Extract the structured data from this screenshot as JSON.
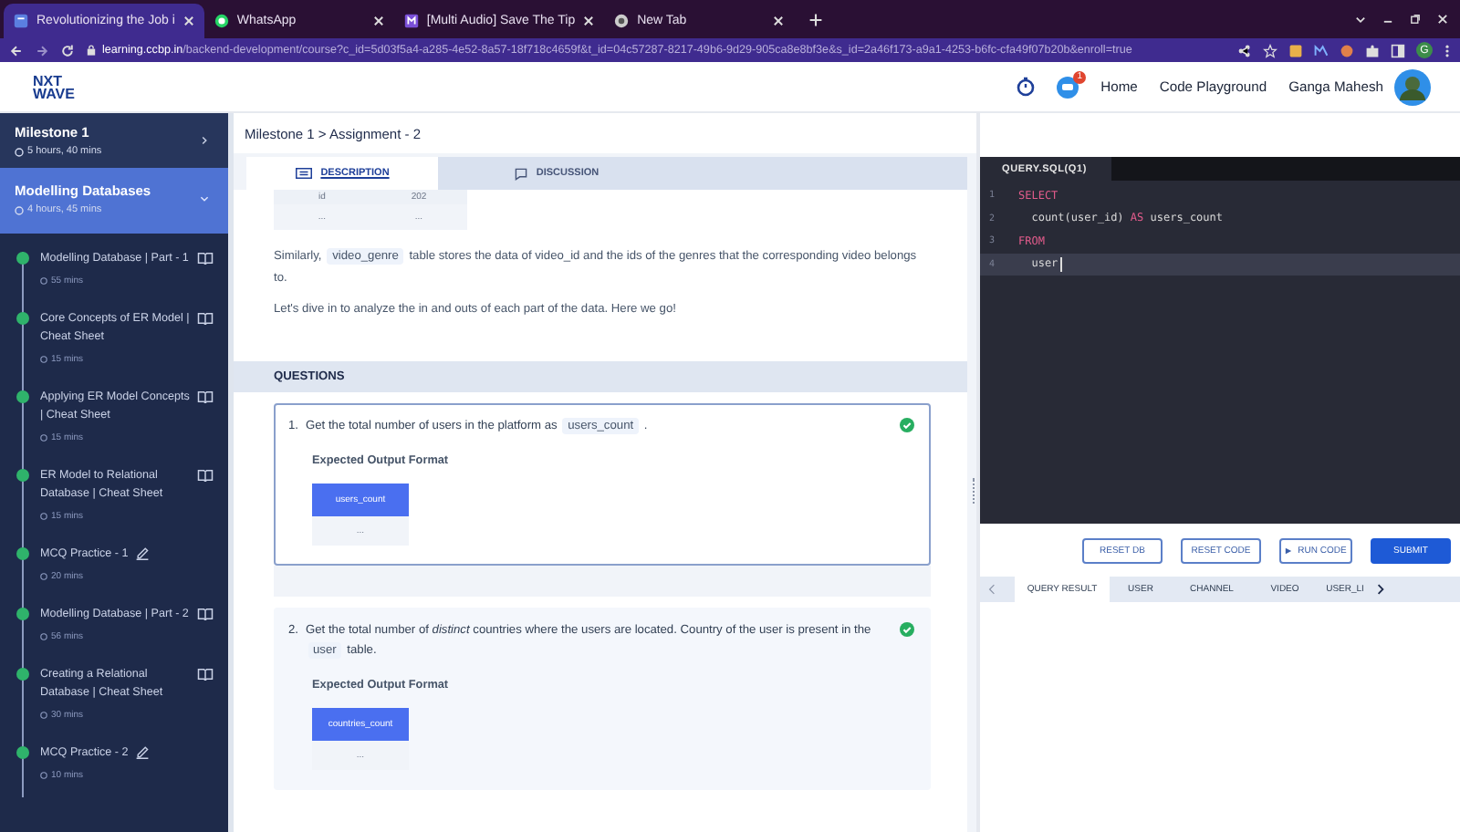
{
  "browser": {
    "tabs": [
      {
        "title": "Revolutionizing the Job i",
        "selected": true
      },
      {
        "title": "WhatsApp",
        "selected": false
      },
      {
        "title": "[Multi Audio] Save The Tip",
        "selected": false
      },
      {
        "title": "New Tab",
        "selected": false
      }
    ],
    "url": {
      "host": "learning.ccbp.in",
      "path": "/backend-development/course?c_id=5d03f5a4-a285-4e52-8a57-18f718c4659f&t_id=04c57287-8217-49b6-9d29-905ca8e8bf3e&s_id=2a46f173-a9a1-4253-b6fc-cfa49f07b20b&enroll=true"
    },
    "profile_initial": "G"
  },
  "header": {
    "logo_top": "NXT",
    "logo_bottom": "WAVE",
    "notification_count": "1",
    "nav": [
      "Home",
      "Code Playground"
    ],
    "user": "Ganga Mahesh"
  },
  "sidebar": {
    "sections": [
      {
        "title": "Milestone 1",
        "duration": "5 hours, 40 mins",
        "expanded": false
      },
      {
        "title": "Modelling Databases",
        "duration": "4 hours, 45 mins",
        "expanded": true
      }
    ],
    "items": [
      {
        "title": "Modelling Database | Part - 1",
        "duration": "55 mins",
        "kind": "reading",
        "completed": true
      },
      {
        "title": "Core Concepts of ER Model | Cheat Sheet",
        "duration": "15 mins",
        "kind": "reading",
        "completed": true
      },
      {
        "title": "Applying ER Model Concepts | Cheat Sheet",
        "duration": "15 mins",
        "kind": "reading",
        "completed": true
      },
      {
        "title": "ER Model to Relational Database | Cheat Sheet",
        "duration": "15 mins",
        "kind": "reading",
        "completed": true
      },
      {
        "title": "MCQ Practice - 1",
        "duration": "20 mins",
        "kind": "practice",
        "completed": true
      },
      {
        "title": "Modelling Database | Part - 2",
        "duration": "56 mins",
        "kind": "reading",
        "completed": true
      },
      {
        "title": "Creating a Relational Database | Cheat Sheet",
        "duration": "30 mins",
        "kind": "reading",
        "completed": true
      },
      {
        "title": "MCQ Practice - 2",
        "duration": "10 mins",
        "kind": "practice",
        "completed": true
      }
    ]
  },
  "breadcrumb": "Milestone 1 > Assignment - 2",
  "tabs": [
    {
      "label": "DESCRIPTION",
      "selected": true
    },
    {
      "label": "DISCUSSION",
      "selected": false
    }
  ],
  "sample_table": {
    "header": [
      "id",
      "202"
    ],
    "row": [
      "...",
      "..."
    ]
  },
  "paragraphs": [
    [
      {
        "kind": "text",
        "text": "Similarly, "
      },
      {
        "kind": "code",
        "text": "video_genre"
      },
      {
        "kind": "text",
        "text": " table stores the data of video_id and the ids of the genres that the corresponding video belongs to."
      }
    ],
    [
      {
        "kind": "text",
        "text": "Let's dive in to analyze the in and outs of each part of the data. Here we go!"
      }
    ]
  ],
  "questions_heading": "QUESTIONS",
  "questions": [
    {
      "number": "1.",
      "segments": [
        {
          "kind": "text",
          "text": "Get the total number of users in the platform as "
        },
        {
          "kind": "code",
          "text": "users_count"
        },
        {
          "kind": "text",
          "text": " ."
        }
      ],
      "completed": true,
      "selected": true,
      "format_title": "Expected Output Format",
      "column": "users_count",
      "cell": "..."
    },
    {
      "number": "2.",
      "segments": [
        {
          "kind": "text",
          "text": "Get the total number of *distinct* countries where the users are located. Country of the user is present in the "
        },
        {
          "kind": "code",
          "text": "user"
        },
        {
          "kind": "text",
          "text": " table."
        }
      ],
      "completed": true,
      "selected": false,
      "format_title": "Expected Output Format",
      "column": "countries_count",
      "cell": "..."
    }
  ],
  "editor": {
    "tab": "QUERY.SQL(Q1)",
    "lines": [
      {
        "number": "1",
        "active": false,
        "tokens": [
          {
            "kind": "keyword",
            "text": "SELECT"
          }
        ]
      },
      {
        "number": "2",
        "active": false,
        "tokens": [
          {
            "kind": "plain",
            "text": "  count(user_id) "
          },
          {
            "kind": "keyword",
            "text": "AS"
          },
          {
            "kind": "plain",
            "text": " users_count"
          }
        ]
      },
      {
        "number": "3",
        "active": false,
        "tokens": [
          {
            "kind": "keyword",
            "text": "FROM"
          }
        ]
      },
      {
        "number": "4",
        "active": true,
        "tokens": [
          {
            "kind": "plain",
            "text": "  user"
          }
        ]
      }
    ]
  },
  "actions": [
    {
      "label": "RESET DB",
      "kind": "outline"
    },
    {
      "label": "RESET CODE",
      "kind": "outline"
    },
    {
      "label": "RUN CODE",
      "kind": "run"
    },
    {
      "label": "SUBMIT",
      "kind": "primary"
    }
  ],
  "result_tabs": [
    {
      "label": "QUERY RESULT",
      "selected": true
    },
    {
      "label": "USER",
      "selected": false
    },
    {
      "label": "CHANNEL",
      "selected": false
    },
    {
      "label": "VIDEO",
      "selected": false
    },
    {
      "label": "USER_LI",
      "selected": false
    }
  ]
}
